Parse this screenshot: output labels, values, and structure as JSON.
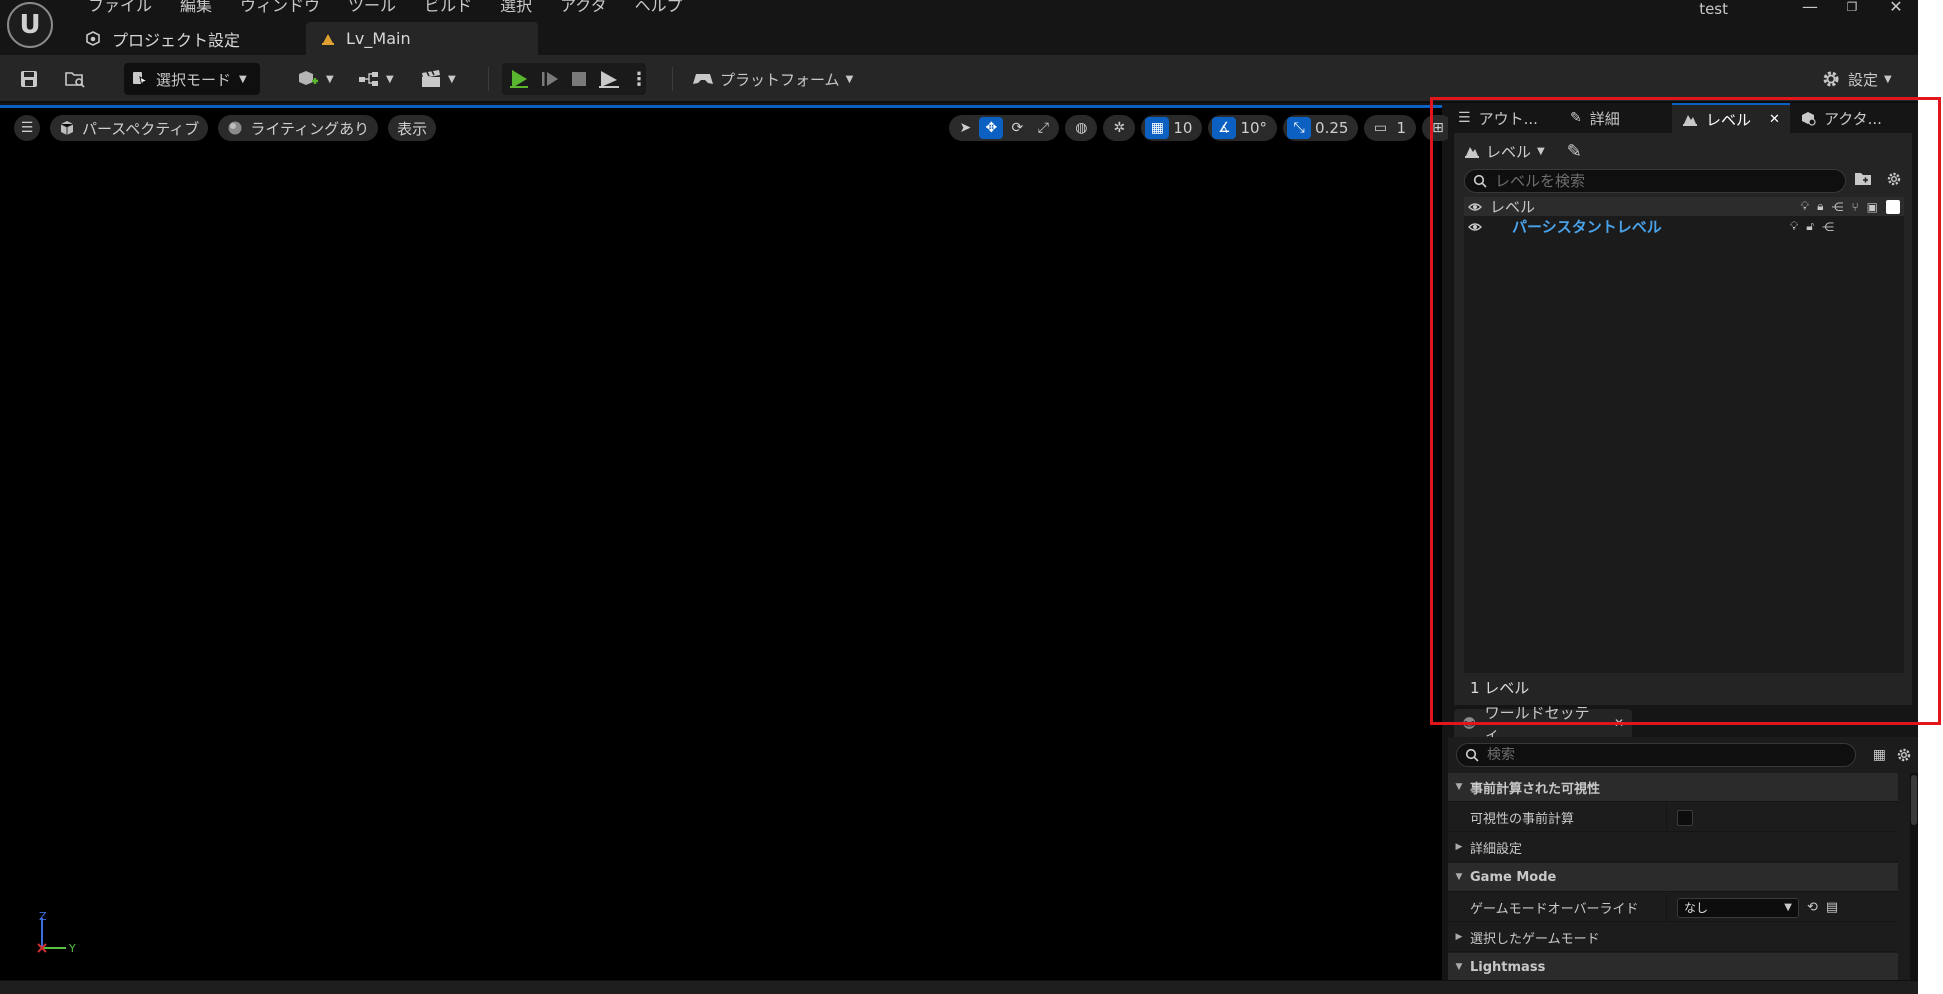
{
  "menu": [
    "ファイル",
    "編集",
    "ウィンドウ",
    "ツール",
    "ビルド",
    "選択",
    "アクタ",
    "ヘルプ"
  ],
  "tabs": {
    "project_settings": "プロジェクト設定",
    "level_main": "Lv_Main"
  },
  "window": {
    "user": "test",
    "minimize": "—",
    "restore": "❐",
    "close": "✕"
  },
  "toolbar": {
    "mode": "選択モード",
    "platform": "プラットフォーム",
    "settings": "設定"
  },
  "viewport": {
    "perspective": "パースペクティブ",
    "lighting": "ライティングあり",
    "show": "表示",
    "grid_snap": "10",
    "rotation_snap": "10°",
    "scale_snap": "0.25",
    "camera_speed": "1",
    "axis_z": "Z",
    "axis_y": "Y"
  },
  "right_tabs": {
    "outliner": "アウト...",
    "details": "詳細",
    "levels": "レベル",
    "actors": "アクタ..."
  },
  "levels_panel": {
    "toolbar_label": "レベル",
    "search_placeholder": "レベルを検索",
    "header": "レベル",
    "persistent_level": "パーシスタントレベル",
    "count": "1 レベル"
  },
  "world_settings": {
    "tab_label": "ワールドセッティ...",
    "search_placeholder": "検索",
    "rows": {
      "cat_precomputed": "事前計算された可視性",
      "precompute_visibility": "可視性の事前計算",
      "advanced": "詳細設定",
      "cat_gamemode": "Game Mode",
      "gamemode_override": "ゲームモードオーバーライド",
      "gamemode_override_value": "なし",
      "selected_gamemode": "選択したゲームモード",
      "cat_lightmass": "Lightmass"
    }
  },
  "colors": {
    "accent": "#0b60c2",
    "play_green": "#5ab52f",
    "highlight_red": "#e0161c",
    "persistent_level": "#4aa3ea"
  }
}
